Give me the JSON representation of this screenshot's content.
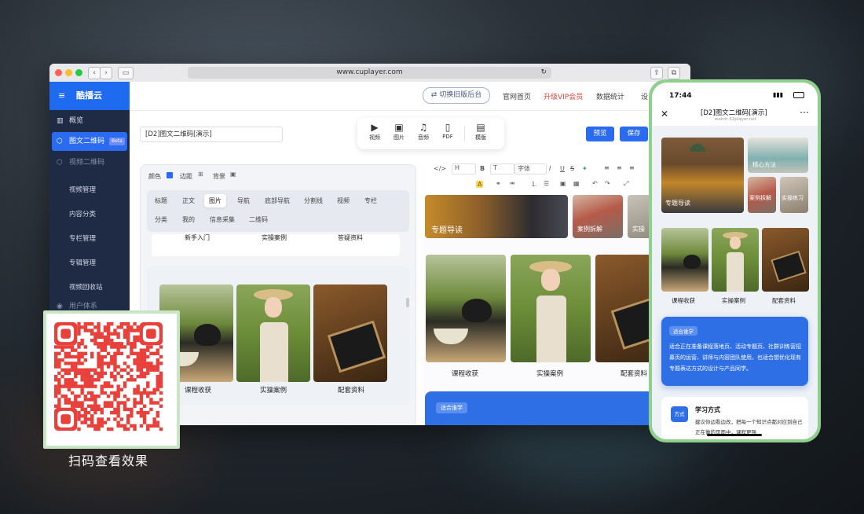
{
  "browser": {
    "url": "www.cuplayer.com"
  },
  "sidebar": {
    "brand": "酷播云",
    "items": [
      {
        "label": "概览"
      },
      {
        "label": "图文二维码",
        "badge": "Beta"
      },
      {
        "label": "视频二维码"
      },
      {
        "label": "视频管理"
      },
      {
        "label": "内容分类"
      },
      {
        "label": "专栏管理"
      },
      {
        "label": "专辑管理"
      },
      {
        "label": "视频回收站"
      },
      {
        "label": "用户体系"
      }
    ]
  },
  "topnav": {
    "switch_label": "切换旧版后台",
    "links": [
      "官网首页",
      "升级VIP会员",
      "数据统计",
      "设"
    ],
    "vip_color": "#e8403b"
  },
  "editor": {
    "title_value": "[D2]图文二维码[演示]",
    "insert_tools": [
      {
        "icon": "video-icon",
        "label": "视频"
      },
      {
        "icon": "image-icon",
        "label": "图片"
      },
      {
        "icon": "music-icon",
        "label": "音频"
      },
      {
        "icon": "pdf-icon",
        "label": "PDF"
      },
      {
        "icon": "template-icon",
        "label": "模版"
      }
    ],
    "preview_label": "预览",
    "save_label": "保存",
    "style_labels": {
      "color": "颜色",
      "border": "边距",
      "background": "背景"
    },
    "block_tabs_row1": [
      "标题",
      "正文",
      "图片",
      "导航",
      "底部导航",
      "分割线",
      "视频",
      "专栏"
    ],
    "block_tabs_row2": [
      "分类",
      "我的",
      "信息采集",
      "二维码"
    ],
    "selected_tab": "图片",
    "nav_strip": [
      "新手入门",
      "实操案例",
      "答疑资料"
    ],
    "image_captions": [
      "课程收获",
      "实操案例",
      "配套资料"
    ]
  },
  "rich_toolbar": {
    "heading": "H",
    "font": "字体"
  },
  "preview": {
    "banner_labels": [
      "专题导读",
      "案例拆解",
      "实操"
    ],
    "image_captions": [
      "课程收获",
      "实操案例",
      "配套资料"
    ],
    "tag": "适合谁学"
  },
  "phone": {
    "time": "17:44",
    "title": "[D2]图文二维码[演示]",
    "subtitle": "watch.52player.net",
    "banner_labels": [
      "专题导读",
      "核心方法",
      "案例拆解",
      "实操练习"
    ],
    "image_captions": [
      "课程收获",
      "实操案例",
      "配套资料"
    ],
    "who_tag": "适合谁学",
    "who_text": "适合正在准备课程落地页、活动专题页、社群训练营招募页的运营、讲师与内容团队使用，也适合想优化现有专题表达方式的设计与产品同学。",
    "method_badge": "方式",
    "method_title": "学习方式",
    "method_text": "建议你边看边改，把每一个知识点都对应到自己正在做的页面中，课程更强"
  },
  "qr": {
    "label": "扫码查看效果",
    "color": "#e8403b"
  }
}
